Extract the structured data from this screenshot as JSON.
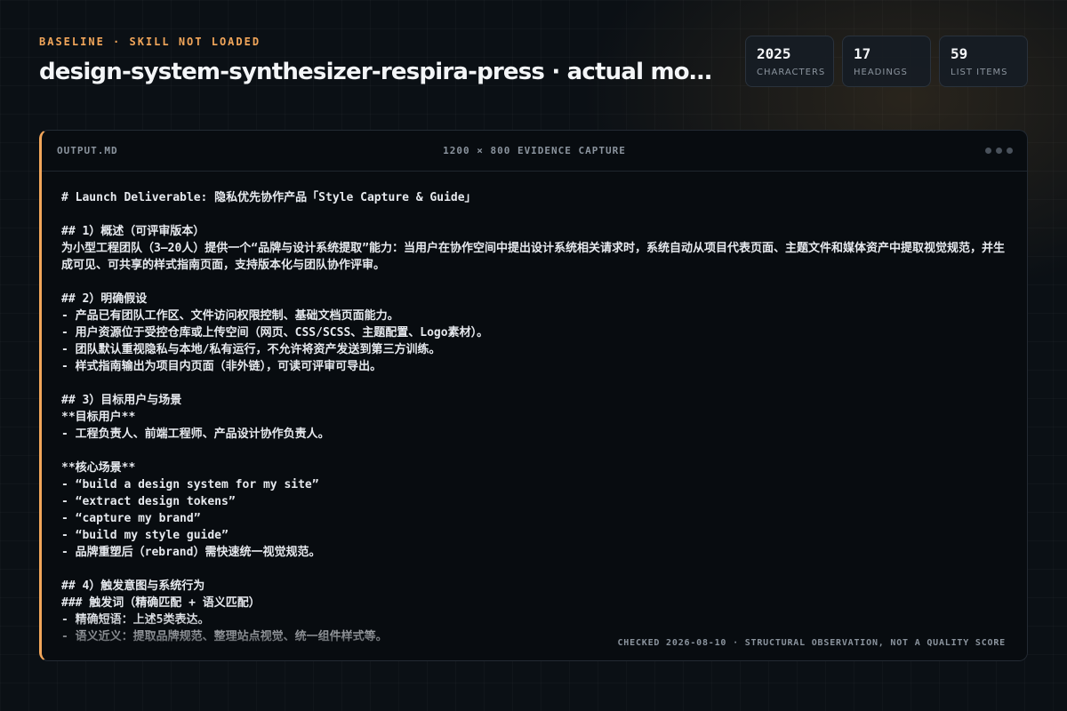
{
  "header": {
    "kicker": "BASELINE · SKILL NOT LOADED",
    "title": "design-system-synthesizer-respira-press · actual mod..."
  },
  "stats": [
    {
      "value": "2025",
      "label": "CHARACTERS"
    },
    {
      "value": "17",
      "label": "HEADINGS"
    },
    {
      "value": "59",
      "label": "LIST ITEMS"
    }
  ],
  "panel": {
    "file_name": "OUTPUT.MD",
    "capture_label": "1200 × 800 EVIDENCE CAPTURE",
    "footnote": "CHECKED 2026-08-10 · STRUCTURAL OBSERVATION, NOT A QUALITY SCORE",
    "lines": [
      "# Launch Deliverable: 隐私优先协作产品「Style Capture & Guide」",
      "",
      "## 1）概述（可评审版本）",
      "为小型工程团队（3–20人）提供一个“品牌与设计系统提取”能力：当用户在协作空间中提出设计系统相关请求时，系统自动从项目代表页面、主题文件和媒体资产中提取视觉规范，并生成可见、可共享的样式指南页面，支持版本化与团队协作评审。",
      "",
      "## 2）明确假设",
      "- 产品已有团队工作区、文件访问权限控制、基础文档页面能力。",
      "- 用户资源位于受控仓库或上传空间（网页、CSS/SCSS、主题配置、Logo素材）。",
      "- 团队默认重视隐私与本地/私有运行，不允许将资产发送到第三方训练。",
      "- 样式指南输出为项目内页面（非外链），可读可评审可导出。",
      "",
      "## 3）目标用户与场景",
      "**目标用户**",
      "- 工程负责人、前端工程师、产品设计协作负责人。",
      "",
      "**核心场景**",
      "- “build a design system for my site”",
      "- “extract design tokens”",
      "- “capture my brand”",
      "- “build my style guide”",
      "- 品牌重塑后（rebrand）需快速统一视觉规范。",
      "",
      "## 4）触发意图与系统行为",
      "### 触发词（精确匹配 + 语义匹配）",
      "- 精确短语：上述5类表达。",
      "- 语义近义：提取品牌规范、整理站点视觉、统一组件样式等。"
    ]
  }
}
